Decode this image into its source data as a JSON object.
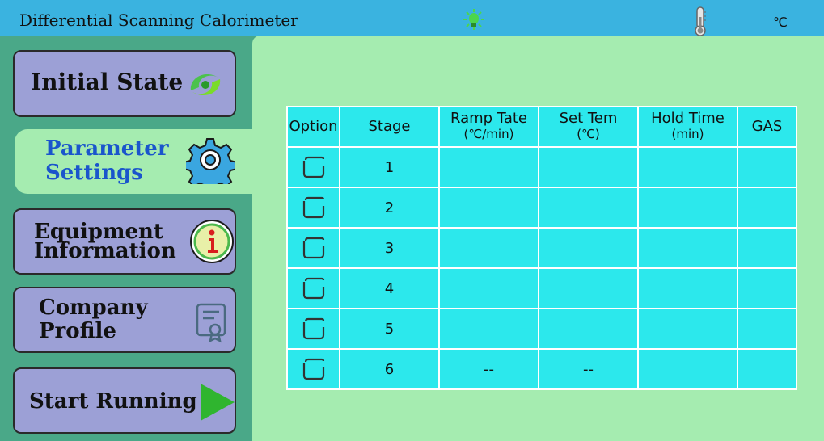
{
  "header": {
    "title": "Differential Scanning Calorimeter",
    "temperature_unit": "℃",
    "status_light_color": "#4cd64c"
  },
  "sidebar": {
    "items": [
      {
        "label_lines": [
          "Initial State"
        ],
        "icon": "swirl-icon",
        "active": false
      },
      {
        "label_lines": [
          "Parameter",
          "Settings"
        ],
        "icon": "gear-icon",
        "active": true
      },
      {
        "label_lines": [
          "Equipment",
          "Information"
        ],
        "icon": "info-icon",
        "active": false
      },
      {
        "label_lines": [
          "Company",
          "Profile"
        ],
        "icon": "certificate-icon",
        "active": false
      },
      {
        "label_lines": [
          "Start Running"
        ],
        "icon": "play-icon",
        "active": false
      }
    ]
  },
  "table": {
    "headers": [
      {
        "line1": "Option",
        "line2": ""
      },
      {
        "line1": "Stage",
        "line2": ""
      },
      {
        "line1": "Ramp Tate",
        "line2": "(℃/min)"
      },
      {
        "line1": "Set Tem",
        "line2": "(℃)"
      },
      {
        "line1": "Hold Time",
        "line2": "(min)"
      },
      {
        "line1": "GAS",
        "line2": ""
      }
    ],
    "rows": [
      {
        "stage": "1",
        "ramp": "",
        "set_tem": "",
        "hold": "",
        "gas": ""
      },
      {
        "stage": "2",
        "ramp": "",
        "set_tem": "",
        "hold": "",
        "gas": ""
      },
      {
        "stage": "3",
        "ramp": "",
        "set_tem": "",
        "hold": "",
        "gas": ""
      },
      {
        "stage": "4",
        "ramp": "",
        "set_tem": "",
        "hold": "",
        "gas": ""
      },
      {
        "stage": "5",
        "ramp": "",
        "set_tem": "",
        "hold": "",
        "gas": ""
      },
      {
        "stage": "6",
        "ramp": "--",
        "set_tem": "--",
        "hold": "",
        "gas": ""
      }
    ]
  },
  "colors": {
    "topbar": "#3ab3e0",
    "sidebar": "#4aa888",
    "panel": "#a5ecb0",
    "nav_button": "#9ca0d6",
    "active_text": "#1a55cc",
    "table_cell": "#2ce8ec"
  }
}
